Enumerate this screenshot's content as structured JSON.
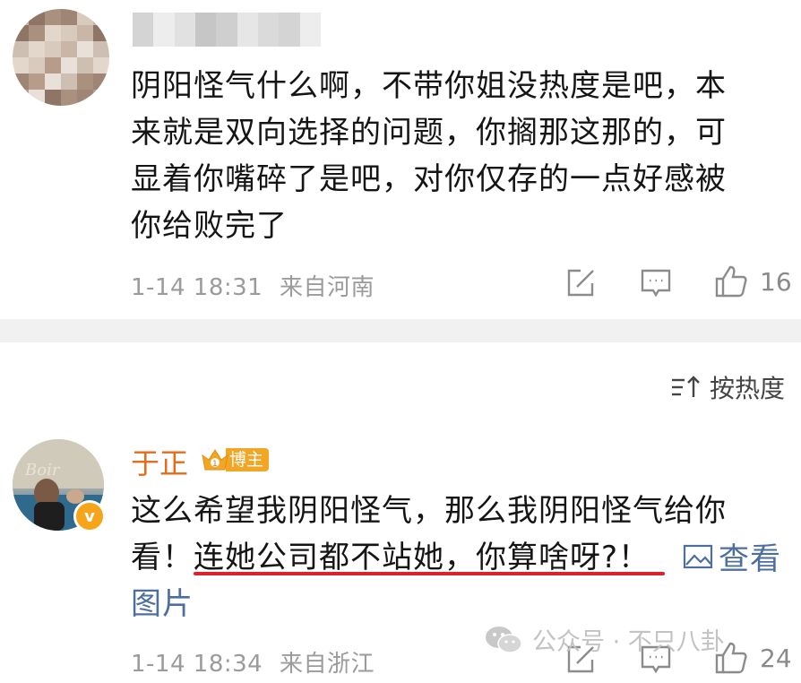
{
  "comment1": {
    "lines": [
      "阴阳怪气什么啊，不带你姐没热度是吧，本",
      "来就是双向选择的问题，你搁那这那的，可",
      "显着你嘴碎了是吧，对你仅存的一点好感被",
      "你给败完了"
    ],
    "time": "1-14 18:31",
    "location": "来自河南",
    "likes": "16"
  },
  "sort": {
    "label": "按热度"
  },
  "comment2": {
    "username": "于正",
    "badge": "博主",
    "line1": "这么希望我阴阳怪气，那么我阴阳怪气给你",
    "line2_prefix": "看！",
    "line2_highlight": "连她公司都不站她，你算啥呀?！",
    "view_image": "查看",
    "view_image_cont": "图片",
    "time": "1-14 18:34",
    "location": "来自浙江",
    "likes": "24"
  },
  "watermark": {
    "text": "公众号 · 不只八卦"
  },
  "colors": {
    "username": "#e26d1c",
    "link": "#4d6fa0",
    "underline": "#d9232e",
    "badge": "#f2a624"
  }
}
